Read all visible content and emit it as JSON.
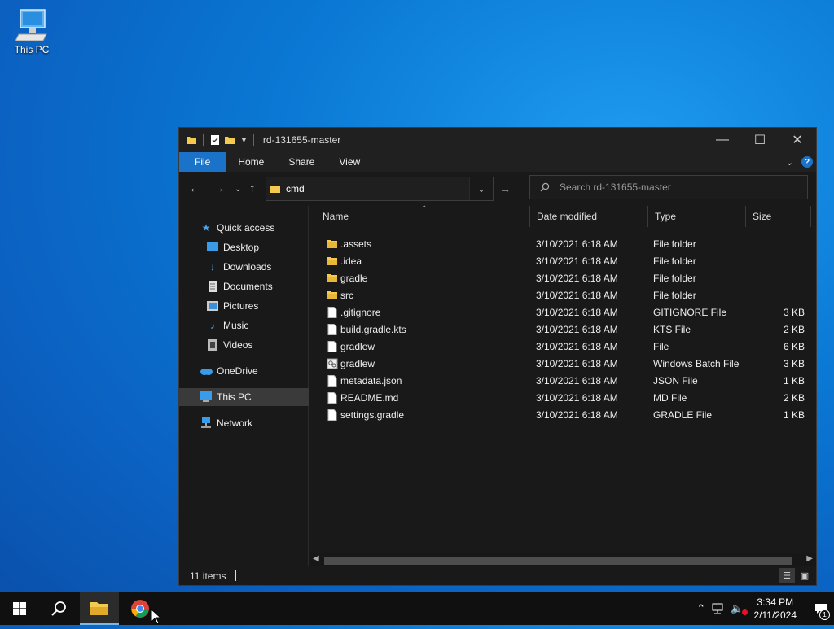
{
  "desktop": {
    "icon_label": "This PC"
  },
  "window": {
    "title": "rd-131655-master",
    "ribbon_tabs": [
      "File",
      "Home",
      "Share",
      "View"
    ],
    "address": "cmd",
    "search_placeholder": "Search rd-131655-master",
    "nav": {
      "quick_access": "Quick access",
      "desktop": "Desktop",
      "downloads": "Downloads",
      "documents": "Documents",
      "pictures": "Pictures",
      "music": "Music",
      "videos": "Videos",
      "onedrive": "OneDrive",
      "this_pc": "This PC",
      "network": "Network"
    },
    "columns": {
      "name": "Name",
      "date": "Date modified",
      "type": "Type",
      "size": "Size"
    },
    "files": [
      {
        "name": ".assets",
        "date": "3/10/2021 6:18 AM",
        "type": "File folder",
        "size": "",
        "icon": "folder-icon"
      },
      {
        "name": ".idea",
        "date": "3/10/2021 6:18 AM",
        "type": "File folder",
        "size": "",
        "icon": "folder-icon"
      },
      {
        "name": "gradle",
        "date": "3/10/2021 6:18 AM",
        "type": "File folder",
        "size": "",
        "icon": "folder-icon"
      },
      {
        "name": "src",
        "date": "3/10/2021 6:18 AM",
        "type": "File folder",
        "size": "",
        "icon": "folder-icon"
      },
      {
        "name": ".gitignore",
        "date": "3/10/2021 6:18 AM",
        "type": "GITIGNORE File",
        "size": "3 KB",
        "icon": "file-icon"
      },
      {
        "name": "build.gradle.kts",
        "date": "3/10/2021 6:18 AM",
        "type": "KTS File",
        "size": "2 KB",
        "icon": "file-icon"
      },
      {
        "name": "gradlew",
        "date": "3/10/2021 6:18 AM",
        "type": "File",
        "size": "6 KB",
        "icon": "file-icon"
      },
      {
        "name": "gradlew",
        "date": "3/10/2021 6:18 AM",
        "type": "Windows Batch File",
        "size": "3 KB",
        "icon": "batch-file-icon"
      },
      {
        "name": "metadata.json",
        "date": "3/10/2021 6:18 AM",
        "type": "JSON File",
        "size": "1 KB",
        "icon": "file-icon"
      },
      {
        "name": "README.md",
        "date": "3/10/2021 6:18 AM",
        "type": "MD File",
        "size": "2 KB",
        "icon": "file-icon"
      },
      {
        "name": "settings.gradle",
        "date": "3/10/2021 6:18 AM",
        "type": "GRADLE File",
        "size": "1 KB",
        "icon": "file-icon"
      }
    ],
    "status": "11 items"
  },
  "taskbar": {
    "time": "3:34 PM",
    "date": "2/11/2024",
    "notification_count": "1"
  },
  "colors": {
    "accent": "#1a73c8",
    "folder": "#f4c94e",
    "window_bg": "#191919",
    "taskbar": "#101010"
  }
}
